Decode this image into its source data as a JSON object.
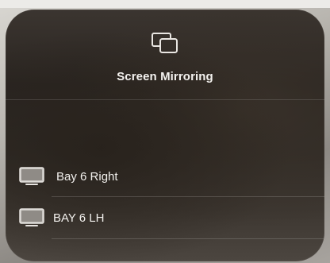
{
  "screen_mirroring": {
    "title": "Screen Mirroring",
    "icon": "screen-mirroring-icon",
    "devices": [
      {
        "name": "Bay 6 Right",
        "icon": "tv-icon"
      },
      {
        "name": "BAY 6 LH",
        "icon": "tv-icon"
      }
    ]
  },
  "colors": {
    "panel_background": "#2a2521",
    "text": "#f4f2ef",
    "icon": "#e9e6e2"
  }
}
